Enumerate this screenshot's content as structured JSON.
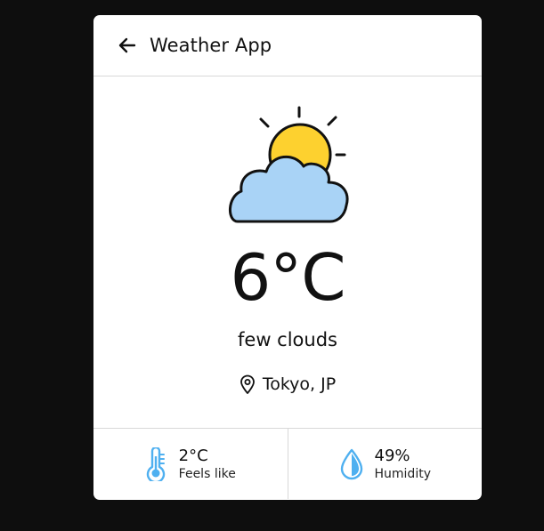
{
  "header": {
    "title": "Weather App",
    "back_icon": "arrow-left-icon"
  },
  "current": {
    "icon": "partly-cloudy-icon",
    "temperature": "6°C",
    "description": "few clouds",
    "location": "Tokyo, JP",
    "location_icon": "map-pin-icon"
  },
  "stats": {
    "feels_like": {
      "value": "2°C",
      "label": "Feels like",
      "icon": "thermometer-icon"
    },
    "humidity": {
      "value": "49%",
      "label": "Humidity",
      "icon": "water-drop-icon"
    }
  },
  "colors": {
    "background": "#0e0e0e",
    "card": "#ffffff",
    "sun": "#fdd12f",
    "cloud": "#a9d3f6",
    "stat_icon": "#4fb0f0"
  }
}
